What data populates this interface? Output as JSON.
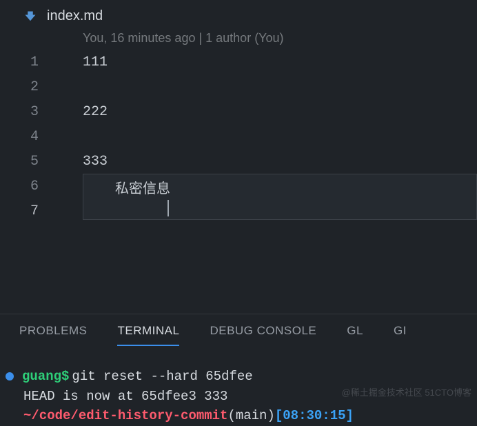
{
  "editor": {
    "file_name": "index.md",
    "blame": "You, 16 minutes ago | 1 author (You)",
    "lines": [
      {
        "num": "1",
        "content": "111"
      },
      {
        "num": "2",
        "content": ""
      },
      {
        "num": "3",
        "content": "222"
      },
      {
        "num": "4",
        "content": ""
      },
      {
        "num": "5",
        "content": "333"
      },
      {
        "num": "6",
        "content": ""
      },
      {
        "num": "7",
        "content": ""
      }
    ],
    "suggestion": "私密信息"
  },
  "panel": {
    "tabs": {
      "problems": "PROBLEMS",
      "terminal": "TERMINAL",
      "debug": "DEBUG CONSOLE",
      "gl": "GL",
      "gi": "GI"
    }
  },
  "terminal": {
    "prompt": "guang$",
    "command": " git reset --hard 65dfee",
    "output": "HEAD is now at 65dfee3 333",
    "path_fragment": "~/code/edit-history-commit",
    "branch": " (main) ",
    "time_fragment": "[08:30:15]"
  },
  "watermark": "@稀土掘金技术社区 51CTO博客"
}
